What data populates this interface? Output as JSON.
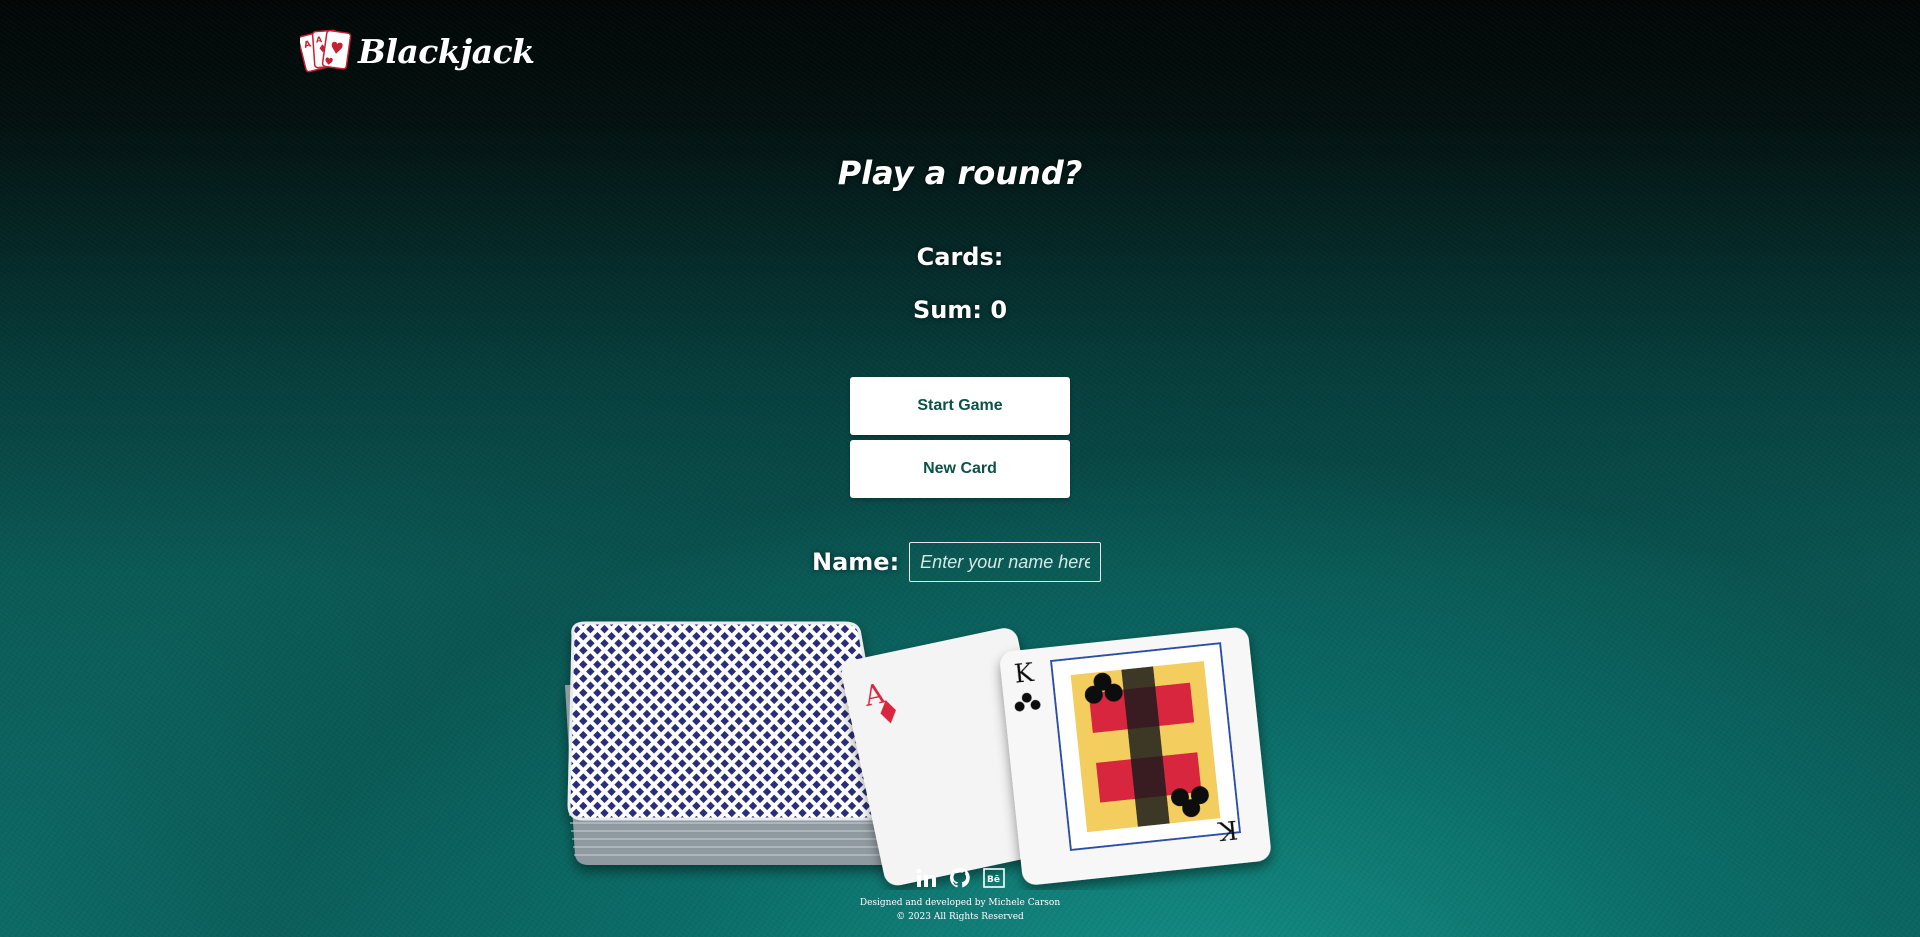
{
  "header": {
    "logo_text": "Blackjack",
    "logo_icon": "playing-cards-icon"
  },
  "main": {
    "title": "Play a round?",
    "cards_label": "Cards:",
    "sum_label": "Sum: 0",
    "start_button": "Start Game",
    "new_card_button": "New Card",
    "name_label": "Name:",
    "name_input": {
      "value": "",
      "placeholder": "Enter your name here"
    }
  },
  "illustration": {
    "deck_icon": "card-deck-icon",
    "hand": [
      "A",
      "K"
    ]
  },
  "footer": {
    "social_icons": [
      "linkedin-icon",
      "github-icon",
      "behance-icon"
    ],
    "credit": "Designed and developed by Michele Carson",
    "copyright": "© 2023 All Rights Reserved"
  },
  "colors": {
    "button_text": "#0b5248",
    "button_bg": "#ffffff",
    "felt": "#0d6b66",
    "card_red": "#d7263d"
  }
}
